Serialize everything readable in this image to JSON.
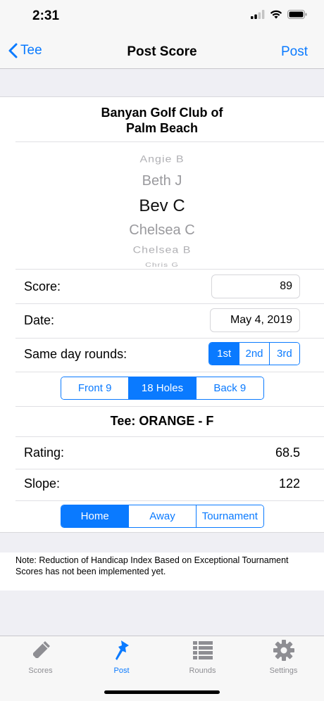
{
  "status": {
    "time": "2:31"
  },
  "nav": {
    "back_label": "Tee",
    "title": "Post Score",
    "action_label": "Post"
  },
  "club": {
    "name_line1": "Banyan Golf Club of",
    "name_line2": "Palm Beach"
  },
  "player_picker": {
    "items": [
      "Angie  B",
      "Beth J",
      "Bev C",
      "Chelsea C",
      "Chelsea B",
      "Chris G"
    ],
    "selected": "Bev C"
  },
  "score": {
    "label": "Score:",
    "value": "89"
  },
  "date": {
    "label": "Date:",
    "value": "May 4, 2019"
  },
  "same_day": {
    "label": "Same day rounds:",
    "options": [
      "1st",
      "2nd",
      "3rd"
    ],
    "selected": "1st"
  },
  "holes": {
    "options": [
      "Front 9",
      "18 Holes",
      "Back 9"
    ],
    "selected": "18 Holes"
  },
  "tee": {
    "label": "Tee: ORANGE - F"
  },
  "rating": {
    "label": "Rating:",
    "value": "68.5"
  },
  "slope": {
    "label": "Slope:",
    "value": "122"
  },
  "round_type": {
    "options": [
      "Home",
      "Away",
      "Tournament"
    ],
    "selected": "Home"
  },
  "note": "Note: Reduction of Handicap Index Based on Exceptional Tournament Scores has not been implemented yet.",
  "tabs": [
    {
      "label": "Scores",
      "icon": "pencil-icon"
    },
    {
      "label": "Post",
      "icon": "pin-icon"
    },
    {
      "label": "Rounds",
      "icon": "list-icon"
    },
    {
      "label": "Settings",
      "icon": "gear-icon"
    }
  ],
  "active_tab": "Post",
  "colors": {
    "accent": "#0a7aff",
    "inactive": "#8e8e93"
  }
}
